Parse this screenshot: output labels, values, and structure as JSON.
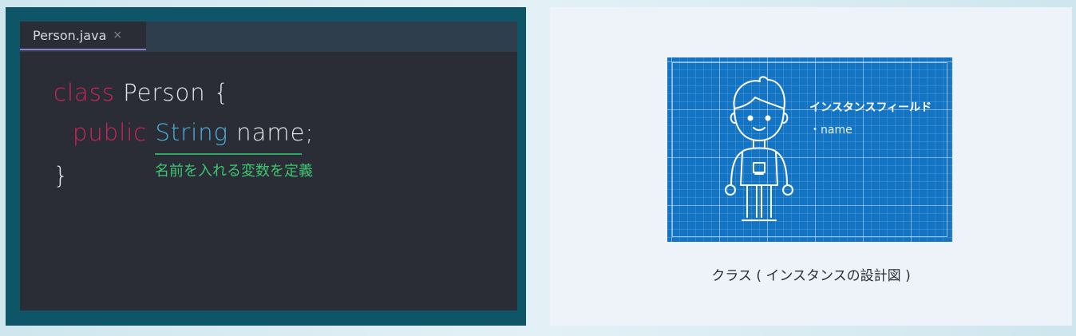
{
  "editor": {
    "tab_label": "Person.java",
    "tab_close_glyph": "×",
    "code": {
      "line1": {
        "keyword": "class",
        "rest": " Person {"
      },
      "line2": {
        "keyword": "public",
        "type": "String",
        "rest": " name;"
      },
      "line3": {
        "text": "}"
      }
    },
    "annotation": "名前を入れる変数を定義",
    "colors": {
      "keyword": "#d2245a",
      "type": "#4ab3e0",
      "annotation": "#3ec570"
    }
  },
  "blueprint": {
    "title": "インスタンスフィールド",
    "field": "・name",
    "figure_icon": "boy-figure-icon",
    "background": "#1474c4",
    "caption": "クラス ( インスタンスの設計図 )"
  }
}
